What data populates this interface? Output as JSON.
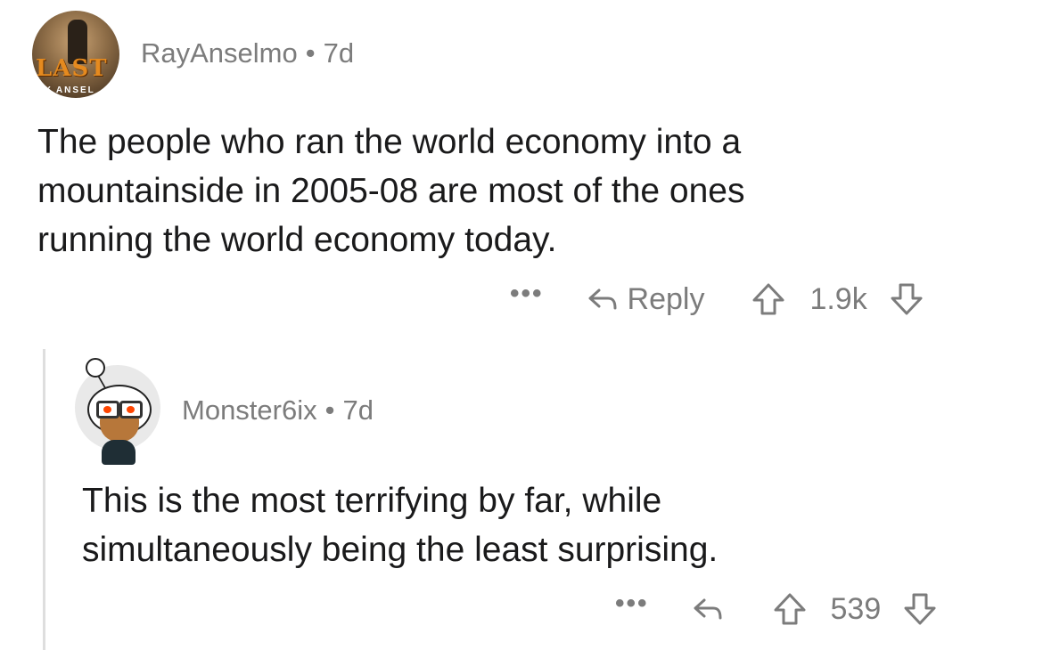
{
  "comments": [
    {
      "avatar": {
        "logo_text": "LAST",
        "sub_text": "Y ANSEL"
      },
      "username": "RayAnselmo",
      "separator": "•",
      "age": "7d",
      "body_lines": [
        "The people who ran the world economy into a",
        "mountainside in 2005-08 are most of the ones",
        "running the world economy today."
      ],
      "more_label": "•••",
      "reply_label": "Reply",
      "score": "1.9k",
      "icons": [
        "reply-arrow-icon",
        "upvote-arrow-icon",
        "downvote-arrow-icon"
      ]
    },
    {
      "username": "Monster6ix",
      "separator": "•",
      "age": "7d",
      "body_lines": [
        "This is the most terrifying by far, while",
        "simultaneously being the least surprising."
      ],
      "more_label": "•••",
      "score": "539",
      "icons": [
        "reply-arrow-icon",
        "upvote-arrow-icon",
        "downvote-arrow-icon"
      ]
    }
  ],
  "colors": {
    "text_primary": "#1a1a1b",
    "text_meta": "#7c7c7c",
    "thread_line": "#dedede",
    "snoo_eye": "#ff4500"
  }
}
